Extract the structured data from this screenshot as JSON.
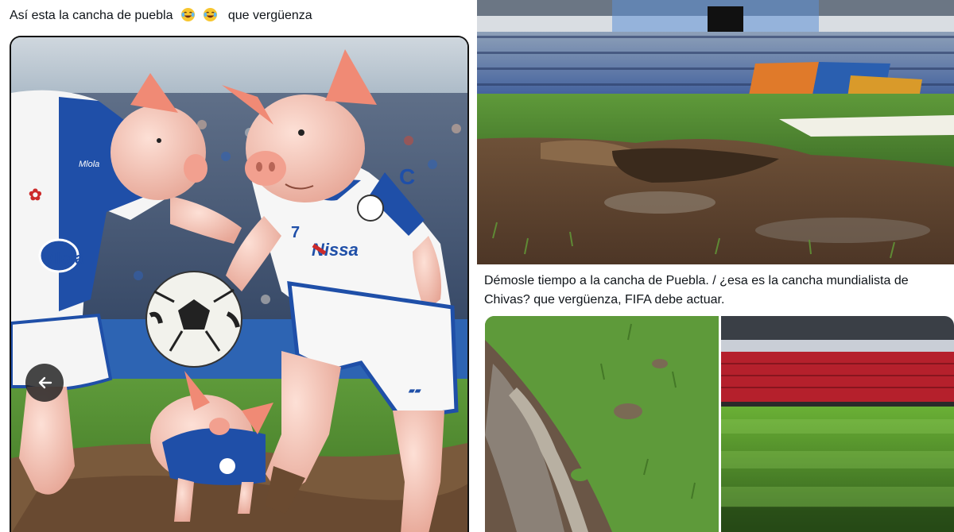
{
  "left_post": {
    "caption": "Así esta la cancha de puebla",
    "caption_suffix": "que vergüenza",
    "emojis": [
      "face-with-tears-of-joy-icon",
      "face-with-tears-of-joy-icon"
    ],
    "image": {
      "jersey_texts": [
        "Mlola",
        "Nissa",
        "Mlola"
      ],
      "number": "7"
    }
  },
  "right_post": {
    "caption": "Démosle tiempo a la cancha de Puebla. / ¿esa es la cancha mundialista de Chivas? que vergüenza, FIFA debe actuar."
  },
  "colors": {
    "grass": "#4f8a2a",
    "mud": "#7a5a3c",
    "jersey_blue": "#1f4fa8",
    "stadium_red": "#b5202c",
    "pig_pink": "#f1b7a8"
  }
}
